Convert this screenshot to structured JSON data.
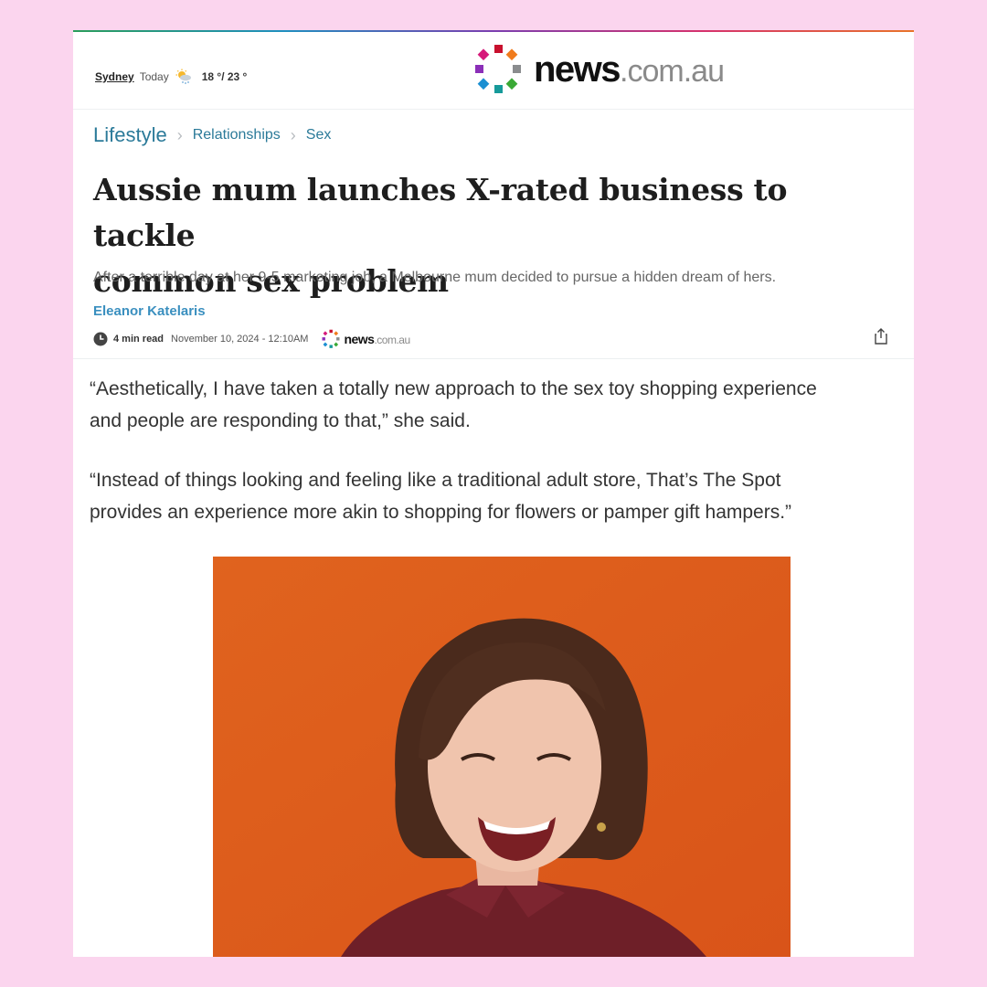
{
  "header": {
    "weather": {
      "city": "Sydney",
      "day": "Today",
      "temps": "18 °/ 23 °",
      "icon": "partly-cloudy-rain-icon"
    },
    "logo": {
      "word": "news",
      "suffix": ".com.au"
    }
  },
  "breadcrumb": {
    "section": "Lifestyle",
    "subsection": "Relationships",
    "topic": "Sex"
  },
  "article": {
    "headline_line1": "Aussie mum launches X-rated business to tackle",
    "headline_line2": "common sex problem",
    "standfirst": "After a terrible day at her 9-5 marketing job, a Melbourne mum decided to pursue a hidden dream of hers.",
    "author": "Eleanor Katelaris",
    "read_time": "4 min read",
    "date": "November 10, 2024 - 12:10AM",
    "paragraph1_line1": "“Aesthetically, I have taken a totally new approach to the sex toy shopping experience",
    "paragraph1_line2": "and people are responding to that,” she said.",
    "paragraph2_line1": "“Instead of things looking and feeling like a traditional adult store, That’s The Spot",
    "paragraph2_line2": "provides an experience more akin to shopping for flowers or pamper gift hampers.”"
  },
  "colors": {
    "background": "#fbd5ee",
    "accent_link": "#2b7a99",
    "author": "#3a8fbf",
    "photo_bg": "#de5d1c"
  }
}
